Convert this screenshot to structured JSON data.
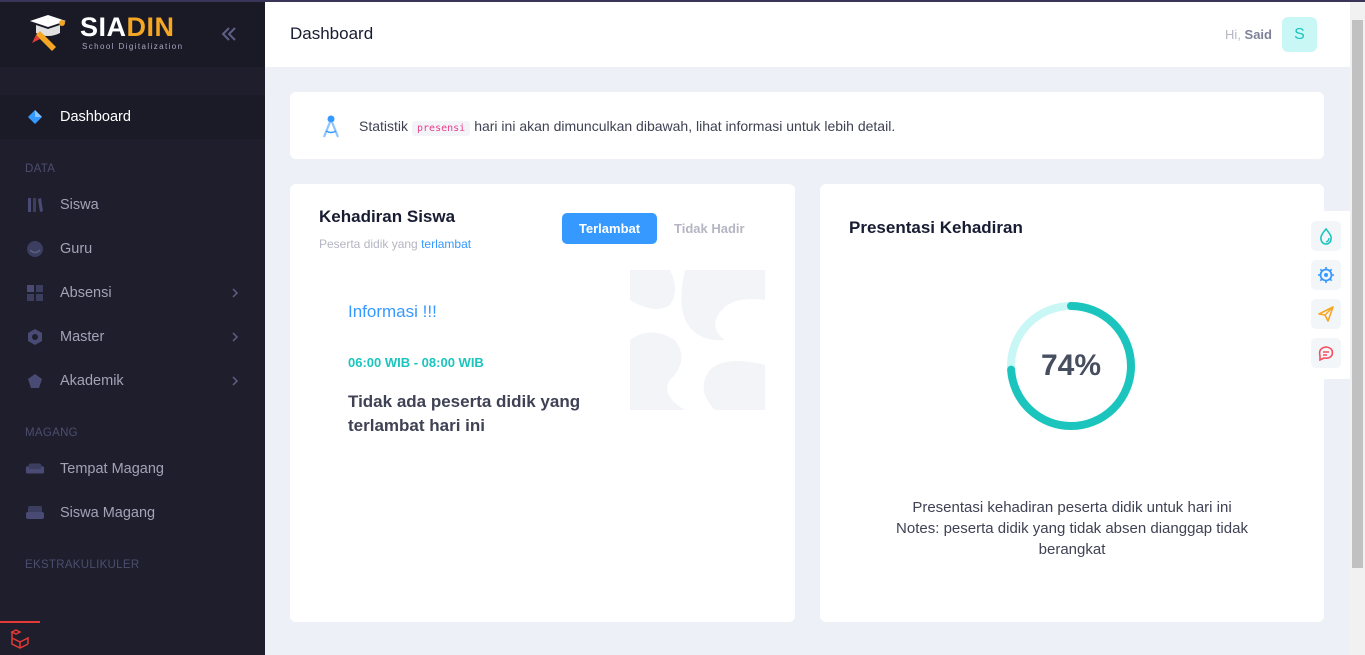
{
  "brand": {
    "name_part1": "SIA",
    "name_part2": "DIN",
    "tagline": "School Digitalization"
  },
  "sidebar": {
    "active": {
      "label": "Dashboard"
    },
    "sections": [
      {
        "title": "DATA"
      },
      {
        "title": "MAGANG"
      },
      {
        "title": "EKSTRAKULIKULER"
      }
    ],
    "items": [
      {
        "label": "Siswa",
        "icon": "library-icon"
      },
      {
        "label": "Guru",
        "icon": "user-icon"
      },
      {
        "label": "Absensi",
        "icon": "grid-icon",
        "has_submenu": true
      },
      {
        "label": "Master",
        "icon": "hexagon-icon",
        "has_submenu": true
      },
      {
        "label": "Akademik",
        "icon": "pentagon-icon",
        "has_submenu": true
      },
      {
        "label": "Tempat Magang",
        "icon": "sofa-icon"
      },
      {
        "label": "Siswa Magang",
        "icon": "armchair-icon"
      }
    ]
  },
  "header": {
    "title": "Dashboard",
    "greeting": "Hi,",
    "user_name": "Said",
    "avatar_letter": "S"
  },
  "alert": {
    "text_before": "Statistik",
    "code": "presensi",
    "text_after": "hari ini akan dimunculkan dibawah, lihat informasi untuk lebih detail."
  },
  "attendance_card": {
    "title": "Kehadiran Siswa",
    "subtitle_prefix": "Peserta didik yang",
    "subtitle_highlight": "terlambat",
    "tabs": [
      {
        "label": "Terlambat",
        "active": true
      },
      {
        "label": "Tidak Hadir",
        "active": false
      }
    ],
    "info_title": "Informasi !!!",
    "info_time": "06:00 WIB - 08:00 WIB",
    "info_message": "Tidak ada peserta didik yang terlambat hari ini"
  },
  "presence_card": {
    "title": "Presentasi Kehadiran",
    "percent_label": "74%",
    "percent_value": 0.74,
    "description_line1": "Presentasi kehadiran peserta didik untuk hari ini",
    "description_line2": "Notes: peserta didik yang tidak absen dianggap tidak berangkat"
  },
  "colors": {
    "sidebar_bg": "#1e1e2d",
    "primary": "#3699ff",
    "success": "#1bc5bd",
    "ring_track": "#c9f7f5",
    "brand_accent": "#f5a623"
  },
  "toolbar": [
    "drop-icon",
    "gear-icon",
    "send-icon",
    "chat-icon"
  ]
}
